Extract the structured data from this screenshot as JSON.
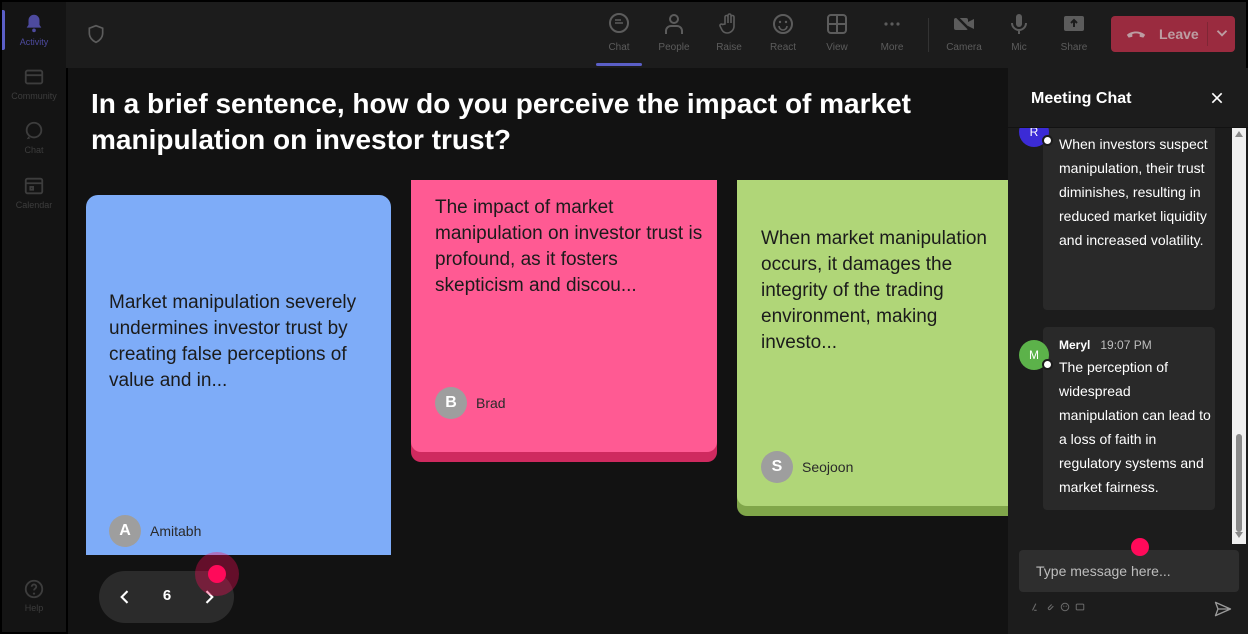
{
  "rail": {
    "items": [
      {
        "label": "Activity",
        "icon": "bell-icon",
        "active": true
      },
      {
        "label": "Community",
        "icon": "community-icon"
      },
      {
        "label": "Chat",
        "icon": "chat-icon"
      },
      {
        "label": "Calendar",
        "icon": "calendar-icon"
      }
    ],
    "help": {
      "label": "Help",
      "icon": "help-icon"
    }
  },
  "toolbar": {
    "buttons": [
      {
        "label": "Chat",
        "icon": "chat-bubble-icon",
        "active": true
      },
      {
        "label": "People",
        "icon": "people-icon"
      },
      {
        "label": "Raise",
        "icon": "hand-icon"
      },
      {
        "label": "React",
        "icon": "smiley-icon"
      },
      {
        "label": "View",
        "icon": "grid-icon"
      },
      {
        "label": "More",
        "icon": "more-icon"
      },
      {
        "label": "Camera",
        "icon": "camera-off-icon"
      },
      {
        "label": "Mic",
        "icon": "mic-icon"
      },
      {
        "label": "Share",
        "icon": "share-icon"
      }
    ],
    "leave_label": "Leave",
    "leave_color": "#c4314b",
    "accent_color": "#5b5fc7"
  },
  "stage": {
    "question": "In a brief sentence, how do you perceive the impact of market manipulation on investor trust?",
    "cards": [
      {
        "text": "Market manipulation severely undermines investor trust by creating false perceptions of value and in...",
        "author": "Amitabh",
        "initial": "A",
        "color": "#7eacf8"
      },
      {
        "text": "The impact of market manipulation on investor trust is profound, as it fosters skepticism and discou...",
        "author": "Brad",
        "initial": "B",
        "color": "#ff5a93"
      },
      {
        "text": "When market manipulation occurs, it damages the integrity of the trading environment, making investo...",
        "author": "Seojoon",
        "initial": "S",
        "color": "#b0d678"
      }
    ],
    "pager": {
      "page": "6"
    }
  },
  "chat": {
    "title": "Meeting Chat",
    "messages": [
      {
        "initial": "R",
        "avatar_color": "#3b2bd6",
        "text": "When investors suspect manipulation, their trust diminishes, resulting in reduced market liquidity and increased volatility."
      },
      {
        "author": "Meryl",
        "time": "19:07 PM",
        "initial": "M",
        "avatar_color": "#5cb24a",
        "text": "The perception of widespread manipulation can lead to a loss of faith in regulatory systems and market fairness."
      }
    ],
    "compose_placeholder": "Type message here..."
  }
}
